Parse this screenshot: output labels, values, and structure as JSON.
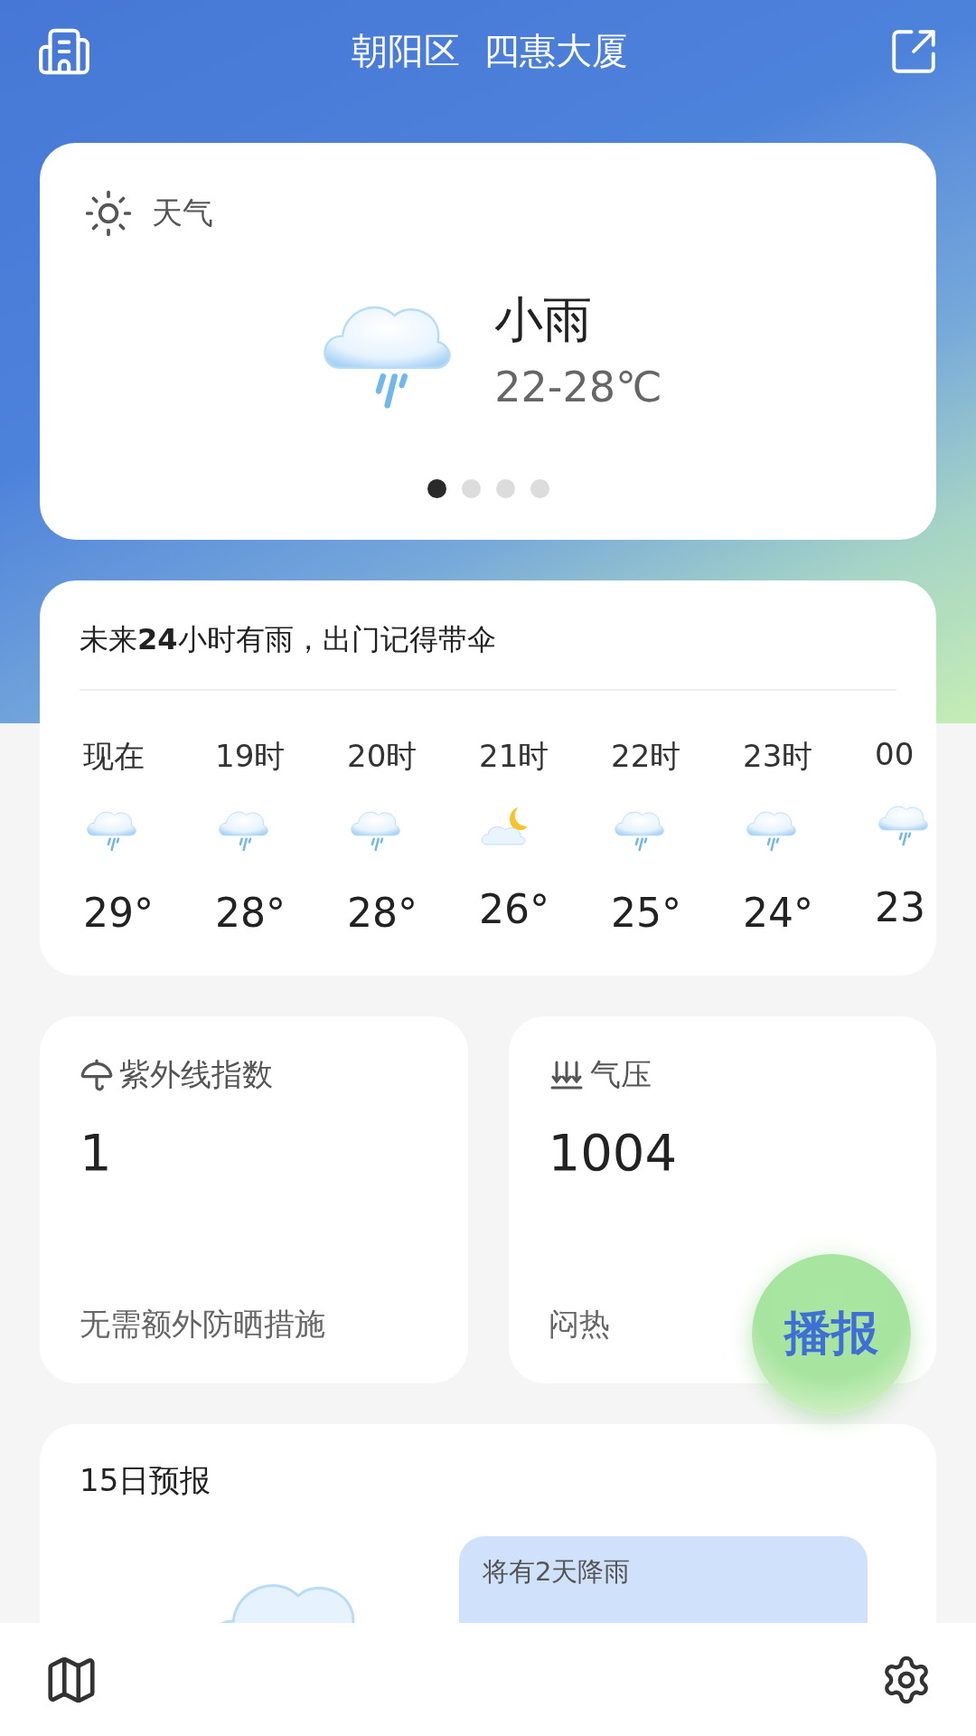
{
  "header": {
    "district": "朝阳区",
    "building": "四惠大厦"
  },
  "weather_card": {
    "label": "天气",
    "condition": "小雨",
    "temperature": "22-28℃",
    "pages": [
      {
        "selected": true
      },
      {
        "selected": false
      },
      {
        "selected": false
      },
      {
        "selected": false
      }
    ]
  },
  "hourly_card": {
    "summary": "未来**24**小时有雨，出门记得带伞",
    "hours": [
      {
        "time": "现在",
        "kind": "rain",
        "temp": "29°"
      },
      {
        "time": "19时",
        "kind": "rain",
        "temp": "28°"
      },
      {
        "time": "20时",
        "kind": "rain",
        "temp": "28°"
      },
      {
        "time": "21时",
        "kind": "moon-cloud",
        "temp": "26°"
      },
      {
        "time": "22时",
        "kind": "rain",
        "temp": "25°"
      },
      {
        "time": "23时",
        "kind": "rain",
        "temp": "24°"
      },
      {
        "time": "00",
        "kind": "rain",
        "temp": "23"
      }
    ]
  },
  "info_cards": [
    {
      "kind": "uv",
      "title": "紫外线指数",
      "value": "1",
      "note": "无需额外防晒措施"
    },
    {
      "kind": "pressure",
      "title": "气压",
      "value": "1004",
      "note": "闷热"
    }
  ],
  "broadcast_button": {
    "label": "播报"
  },
  "forecast_card": {
    "title": "15日预报",
    "bubble": "将有2天降雨"
  }
}
